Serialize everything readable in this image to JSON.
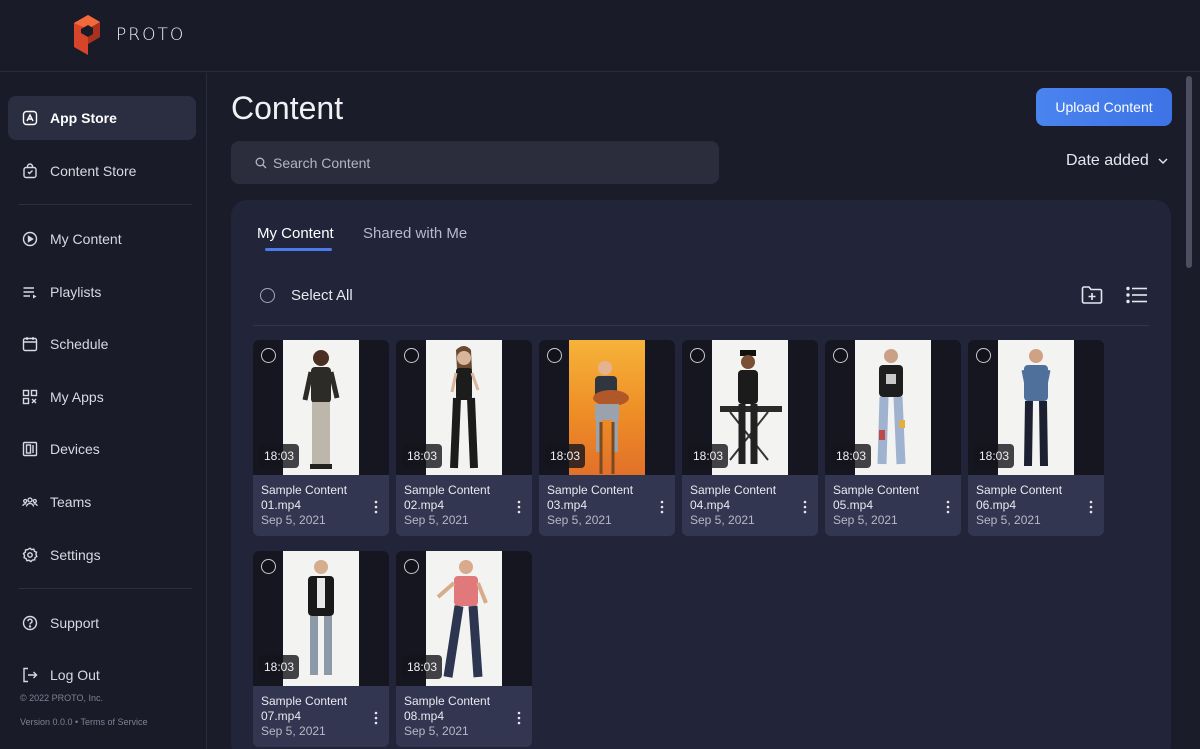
{
  "app": {
    "logo_text": "PROTO"
  },
  "sidebar": {
    "items": [
      {
        "label": "App Store",
        "icon": "app-store-icon",
        "active": true
      },
      {
        "label": "Content Store",
        "icon": "shopping-bag-icon"
      },
      {
        "label": "My Content",
        "icon": "play-circle-icon"
      },
      {
        "label": "Playlists",
        "icon": "playlist-icon"
      },
      {
        "label": "Schedule",
        "icon": "calendar-icon"
      },
      {
        "label": "My Apps",
        "icon": "apps-grid-icon"
      },
      {
        "label": "Devices",
        "icon": "device-icon"
      },
      {
        "label": "Teams",
        "icon": "teams-icon"
      },
      {
        "label": "Settings",
        "icon": "gear-icon"
      },
      {
        "label": "Support",
        "icon": "help-circle-icon"
      },
      {
        "label": "Log Out",
        "icon": "logout-icon"
      }
    ],
    "copyright": "© 2022 PROTO, Inc.",
    "version_line": "Version 0.0.0  •  Terms of Service"
  },
  "header": {
    "title": "Content",
    "upload_label": "Upload Content",
    "search_placeholder": "Search Content",
    "sort_label": "Date added"
  },
  "tabs": [
    {
      "label": "My Content",
      "active": true
    },
    {
      "label": "Shared with Me",
      "active": false
    }
  ],
  "toolbar": {
    "select_all_label": "Select All"
  },
  "colors": {
    "accent": "#4a7be8",
    "background": "#1b1c2a",
    "panel": "#22243a"
  },
  "cards": [
    {
      "title": "Sample Content",
      "file": "01.mp4",
      "date": "Sep 5, 2021",
      "duration": "18:03"
    },
    {
      "title": "Sample Content",
      "file": "02.mp4",
      "date": "Sep 5, 2021",
      "duration": "18:03"
    },
    {
      "title": "Sample Content",
      "file": "03.mp4",
      "date": "Sep 5, 2021",
      "duration": "18:03"
    },
    {
      "title": "Sample Content",
      "file": "04.mp4",
      "date": "Sep 5, 2021",
      "duration": "18:03"
    },
    {
      "title": "Sample Content",
      "file": "05.mp4",
      "date": "Sep 5, 2021",
      "duration": "18:03"
    },
    {
      "title": "Sample Content",
      "file": "06.mp4",
      "date": "Sep 5, 2021",
      "duration": "18:03"
    },
    {
      "title": "Sample Content",
      "file": "07.mp4",
      "date": "Sep 5, 2021",
      "duration": "18:03"
    },
    {
      "title": "Sample Content",
      "file": "08.mp4",
      "date": "Sep 5, 2021",
      "duration": "18:03"
    }
  ]
}
